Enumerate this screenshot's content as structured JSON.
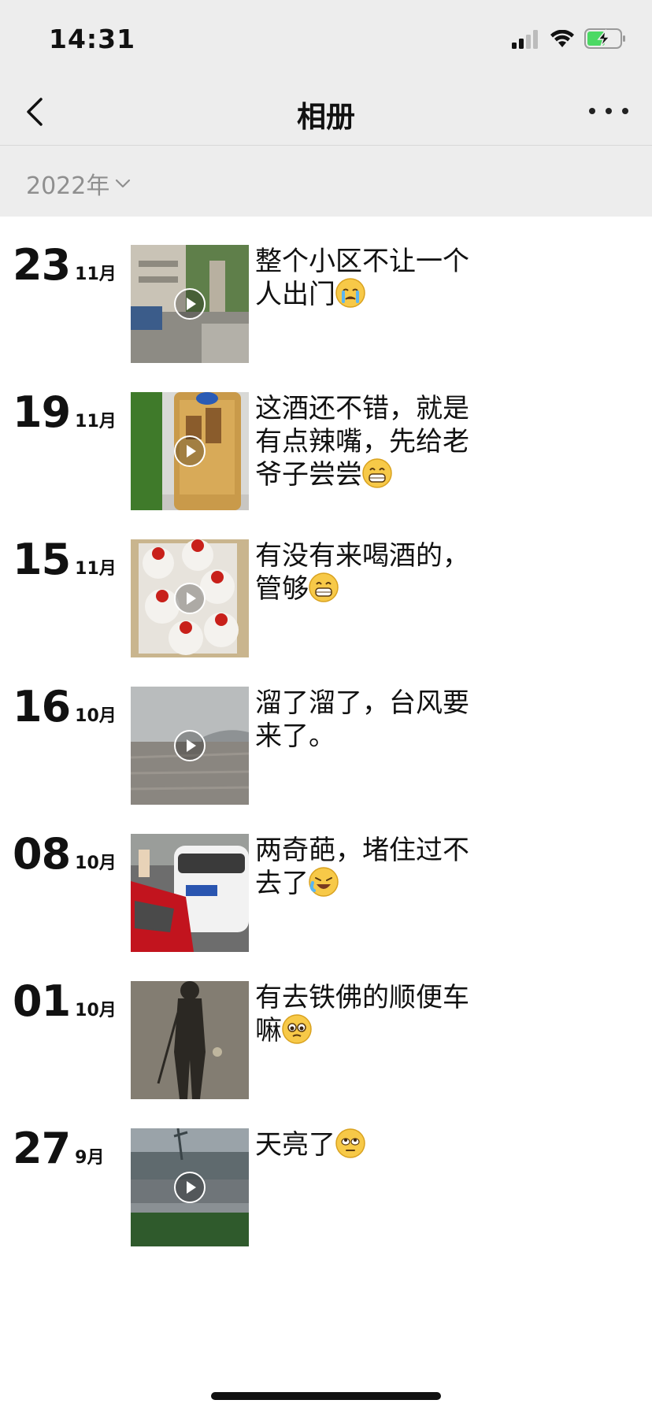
{
  "status_bar": {
    "time": "14:31"
  },
  "nav": {
    "title": "相册"
  },
  "year_filter": {
    "label": "2022年"
  },
  "entries": [
    {
      "day": "23",
      "month": "11月",
      "caption": "整个小区不让一个人出门",
      "emoji": "crying-face-emoji",
      "video": true
    },
    {
      "day": "19",
      "month": "11月",
      "caption": "这酒还不错，就是有点辣嘴，先给老爷子尝尝",
      "emoji": "grinning-face-emoji",
      "video": true
    },
    {
      "day": "15",
      "month": "11月",
      "caption": "有没有来喝酒的，管够",
      "emoji": "grinning-face-emoji",
      "video": true
    },
    {
      "day": "16",
      "month": "10月",
      "caption": "溜了溜了，台风要来了。",
      "emoji": "",
      "video": true
    },
    {
      "day": "08",
      "month": "10月",
      "caption": "两奇葩，堵住过不去了",
      "emoji": "laughing-crying-emoji",
      "video": false
    },
    {
      "day": "01",
      "month": "10月",
      "caption": "有去铁佛的顺便车嘛",
      "emoji": "pleading-face-emoji",
      "video": false
    },
    {
      "day": "27",
      "month": "9月",
      "caption": "天亮了",
      "emoji": "rolling-eyes-emoji",
      "video": true
    }
  ],
  "colors": {
    "bar_bg": "#ededed",
    "year_text": "#8f8f8f",
    "battery_green": "#4cd964"
  }
}
